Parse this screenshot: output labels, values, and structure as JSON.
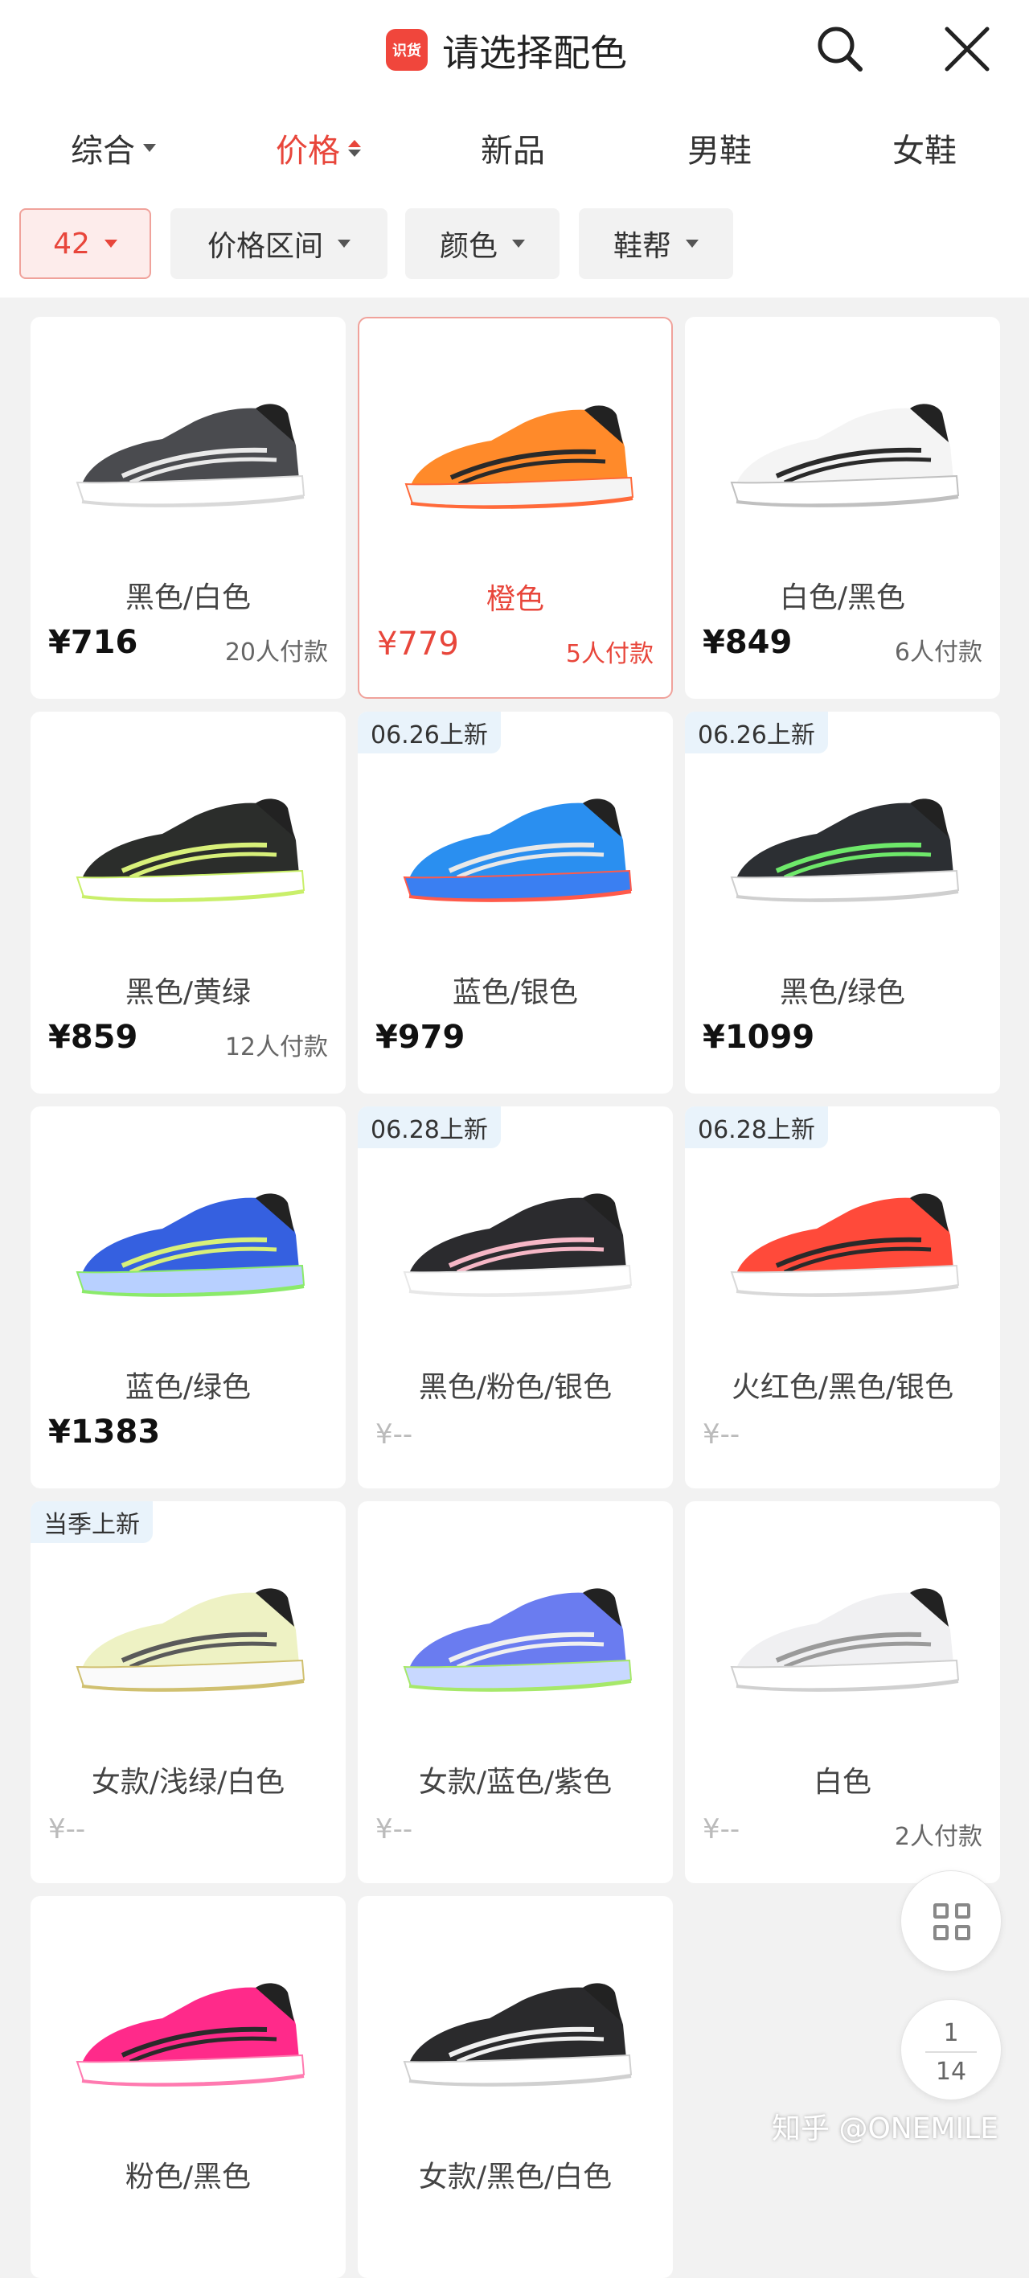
{
  "header": {
    "logo_text": "识货",
    "title": "请选择配色"
  },
  "sort_tabs": [
    {
      "label": "综合"
    },
    {
      "label": "价格"
    },
    {
      "label": "新品"
    },
    {
      "label": "男鞋"
    },
    {
      "label": "女鞋"
    }
  ],
  "filters": [
    {
      "label": "42"
    },
    {
      "label": "价格区间"
    },
    {
      "label": "颜色"
    },
    {
      "label": "鞋帮"
    }
  ],
  "products": [
    {
      "tag": "",
      "name": "黑色/白色",
      "price": "¥716",
      "buyers": "20人付款",
      "upper": "#4a4b4f",
      "accent": "#e9e9e9",
      "sole": "#ffffff",
      "edge": "#d9d9d9"
    },
    {
      "tag": "",
      "name": "橙色",
      "price": "¥779",
      "buyers": "5人付款",
      "upper": "#ff8a2a",
      "accent": "#2a2a2a",
      "sole": "#f4f4f4",
      "edge": "#ff6a3a"
    },
    {
      "tag": "",
      "name": "白色/黑色",
      "price": "¥849",
      "buyers": "6人付款",
      "upper": "#f4f4f4",
      "accent": "#2a2a2a",
      "sole": "#ffffff",
      "edge": "#c0c0c0"
    },
    {
      "tag": "",
      "name": "黑色/黄绿",
      "price": "¥859",
      "buyers": "12人付款",
      "upper": "#2b2d2b",
      "accent": "#d8f07a",
      "sole": "#ffffff",
      "edge": "#c9ef6a"
    },
    {
      "tag": "06.26上新",
      "name": "蓝色/银色",
      "price": "¥979",
      "buyers": "",
      "upper": "#2a8ff0",
      "accent": "#e8e8e8",
      "sole": "#3a7ff2",
      "edge": "#ff5a4a"
    },
    {
      "tag": "06.26上新",
      "name": "黑色/绿色",
      "price": "¥1099",
      "buyers": "",
      "upper": "#2c2f33",
      "accent": "#6ee86a",
      "sole": "#ffffff",
      "edge": "#cfcfcf"
    },
    {
      "tag": "",
      "name": "蓝色/绿色",
      "price": "¥1383",
      "buyers": "",
      "upper": "#3560e0",
      "accent": "#d8f07a",
      "sole": "#b8d0ff",
      "edge": "#8bea6a"
    },
    {
      "tag": "06.28上新",
      "name": "黑色/粉色/银色",
      "price": "¥--",
      "buyers": "",
      "upper": "#2b2b2e",
      "accent": "#f6b7c6",
      "sole": "#ffffff",
      "edge": "#e8e8e8"
    },
    {
      "tag": "06.28上新",
      "name": "火红色/黑色/银色",
      "price": "¥--",
      "buyers": "",
      "upper": "#ff4a3a",
      "accent": "#2a2a2a",
      "sole": "#ffffff",
      "edge": "#d9d9d9"
    },
    {
      "tag": "当季上新",
      "name": "女款/浅绿/白色",
      "price": "¥--",
      "buyers": "",
      "upper": "#eef2c4",
      "accent": "#5a5a5a",
      "sole": "#fafafa",
      "edge": "#d0c070"
    },
    {
      "tag": "",
      "name": "女款/蓝色/紫色",
      "price": "¥--",
      "buyers": "",
      "upper": "#6a7cf0",
      "accent": "#f0f0f0",
      "sole": "#c8d8ff",
      "edge": "#a6e86a"
    },
    {
      "tag": "",
      "name": "白色",
      "price": "¥--",
      "buyers": "2人付款",
      "upper": "#f0f0f2",
      "accent": "#9a9a9a",
      "sole": "#ffffff",
      "edge": "#d0d0d0"
    },
    {
      "tag": "",
      "name": "粉色/黑色",
      "price": "",
      "buyers": "",
      "upper": "#ff2a8a",
      "accent": "#2a2a2a",
      "sole": "#ffffff",
      "edge": "#ff7ab0"
    },
    {
      "tag": "",
      "name": "女款/黑色/白色",
      "price": "",
      "buyers": "",
      "upper": "#2a2a2c",
      "accent": "#f0f0f0",
      "sole": "#ffffff",
      "edge": "#d0d0d0"
    }
  ],
  "pager": {
    "current": "1",
    "total": "14"
  },
  "watermark": "知乎 @ONEMILE",
  "colors": {
    "accent": "#e8463b",
    "background": "#f2f2f2"
  }
}
